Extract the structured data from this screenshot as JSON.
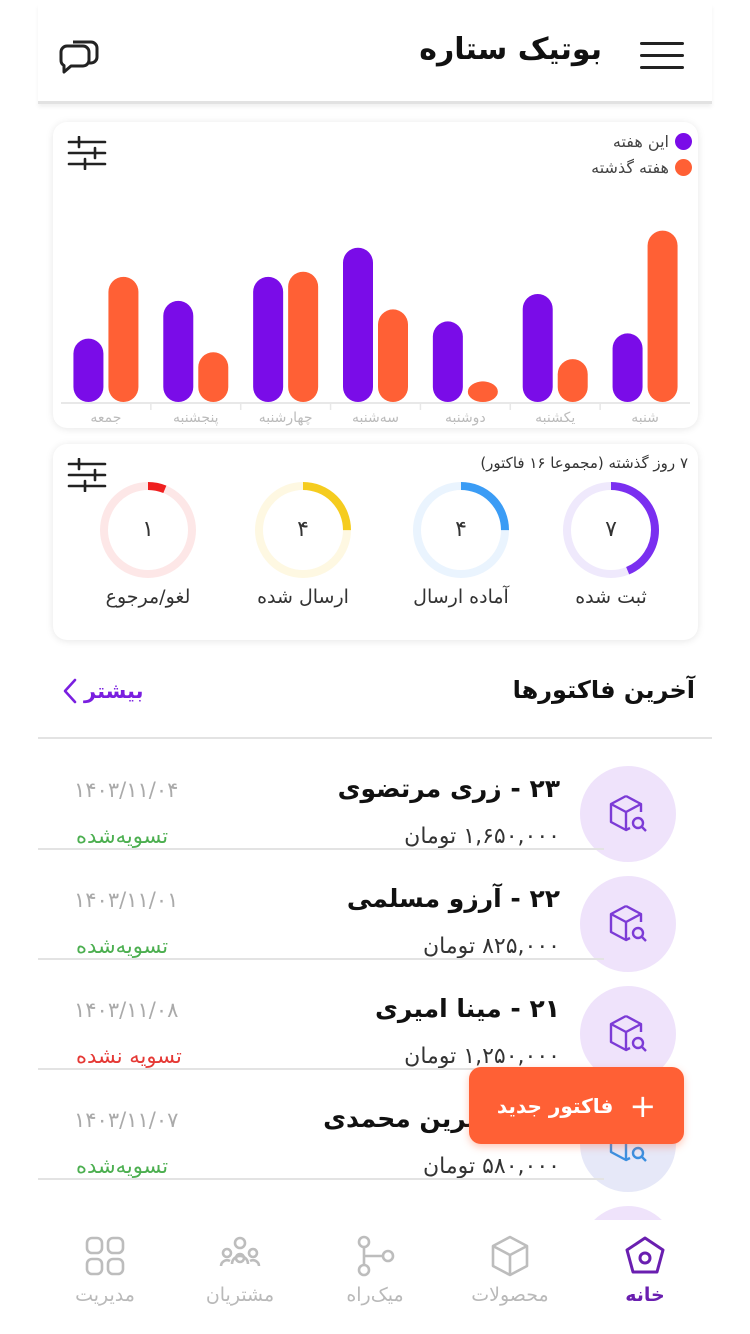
{
  "header": {
    "title": "بوتیک ستاره",
    "menu_icon": "hamburger-menu-icon",
    "chat_icon": "chat-bubbles-icon"
  },
  "chart_data": {
    "type": "bar",
    "categories": [
      "شنبه",
      "یکشنبه",
      "دوشنبه",
      "سه‌شنبه",
      "چهارشنبه",
      "پنجشنبه",
      "جمعه"
    ],
    "series": [
      {
        "name": "این هفته",
        "color": "#7a0ce8",
        "values": [
          4,
          6.3,
          4.7,
          9,
          7.3,
          5.9,
          3.7
        ]
      },
      {
        "name": "هفته گذشته",
        "color": "#ff6035",
        "values": [
          10,
          2.5,
          1.2,
          5.4,
          7.6,
          2.9,
          7.3
        ]
      }
    ],
    "ylim": [
      0,
      10.5
    ],
    "legend": "top-right"
  },
  "status": {
    "period": "۷ روز گذشته (مجموعا ۱۶ فاکتور)",
    "items": [
      {
        "label": "ثبت شده",
        "value": "۷",
        "count": 7,
        "color": "#7a2ff0",
        "track": "#efe9fc"
      },
      {
        "label": "آماده ارسال",
        "value": "۴",
        "count": 4,
        "color": "#3b9cf5",
        "track": "#eaf4fe"
      },
      {
        "label": "ارسال شده",
        "value": "۴",
        "count": 4,
        "color": "#f5cc1f",
        "track": "#fef8e2"
      },
      {
        "label": "لغو/مرجوع",
        "value": "۱",
        "count": 1,
        "color": "#ef1f1f",
        "track": "#fde7e7"
      }
    ],
    "total": 16
  },
  "invoices": {
    "title": "آخرین فاکتورها",
    "more": "بیشتر",
    "items": [
      {
        "name": "۲۳ - زری مرتضوی",
        "amount": "۱,۶۵۰,۰۰۰ تومان",
        "date": "۱۴۰۳/۱۱/۰۴",
        "status": "تسویه‌شده",
        "settled": true
      },
      {
        "name": "۲۲ - آرزو مسلمی",
        "amount": "۸۲۵,۰۰۰ تومان",
        "date": "۱۴۰۳/۱۱/۰۱",
        "status": "تسویه‌شده",
        "settled": true
      },
      {
        "name": "۲۱ - مینا امیری",
        "amount": "۱,۲۵۰,۰۰۰ تومان",
        "date": "۱۴۰۳/۱۱/۰۸",
        "status": "تسویه نشده",
        "settled": false
      },
      {
        "name": "۲۰ - نسرین محمدی",
        "amount": "۵۸۰,۰۰۰ تومان",
        "date": "۱۴۰۳/۱۱/۰۷",
        "status": "تسویه‌شده",
        "settled": true
      }
    ]
  },
  "fab": {
    "label": "فاکتور جدید",
    "plus": "+"
  },
  "nav": {
    "items": [
      {
        "label": "خانه",
        "icon": "home-pentagon-icon",
        "active": true
      },
      {
        "label": "محصولات",
        "icon": "box-icon",
        "active": false
      },
      {
        "label": "میک‌راه",
        "icon": "git-branch-icon",
        "active": false
      },
      {
        "label": "مشتریان",
        "icon": "users-icon",
        "active": false
      },
      {
        "label": "مدیریت",
        "icon": "grid-icon",
        "active": false
      }
    ]
  },
  "colors": {
    "accent": "#7a0ce8",
    "orange": "#ff6035",
    "settled": "#4caf50",
    "unsettled": "#e53935"
  }
}
